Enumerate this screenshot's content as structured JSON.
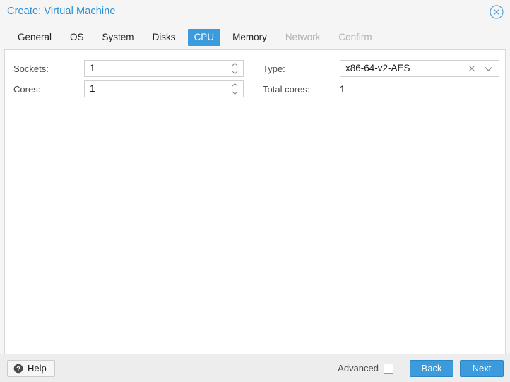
{
  "window": {
    "title": "Create: Virtual Machine",
    "close_icon": "close-circle-icon"
  },
  "tabs": [
    {
      "label": "General",
      "state": "enabled"
    },
    {
      "label": "OS",
      "state": "enabled"
    },
    {
      "label": "System",
      "state": "enabled"
    },
    {
      "label": "Disks",
      "state": "enabled"
    },
    {
      "label": "CPU",
      "state": "active"
    },
    {
      "label": "Memory",
      "state": "enabled"
    },
    {
      "label": "Network",
      "state": "disabled"
    },
    {
      "label": "Confirm",
      "state": "disabled"
    }
  ],
  "form": {
    "sockets": {
      "label": "Sockets:",
      "value": "1"
    },
    "cores": {
      "label": "Cores:",
      "value": "1"
    },
    "type": {
      "label": "Type:",
      "value": "x86-64-v2-AES",
      "clear_icon": "clear-x-icon",
      "dropdown_icon": "chevron-down-icon"
    },
    "total_cores": {
      "label": "Total cores:",
      "value": "1"
    }
  },
  "footer": {
    "help_label": "Help",
    "help_icon": "question-mark-circle-icon",
    "advanced_label": "Advanced",
    "advanced_checked": false,
    "back_label": "Back",
    "next_label": "Next"
  },
  "colors": {
    "accent": "#3c9bdd",
    "title": "#2a8fd6",
    "header_bg": "#f5f5f5",
    "footer_bg": "#ededed",
    "panel_bg": "#ffffff",
    "disabled_text": "#b2b2b2"
  }
}
